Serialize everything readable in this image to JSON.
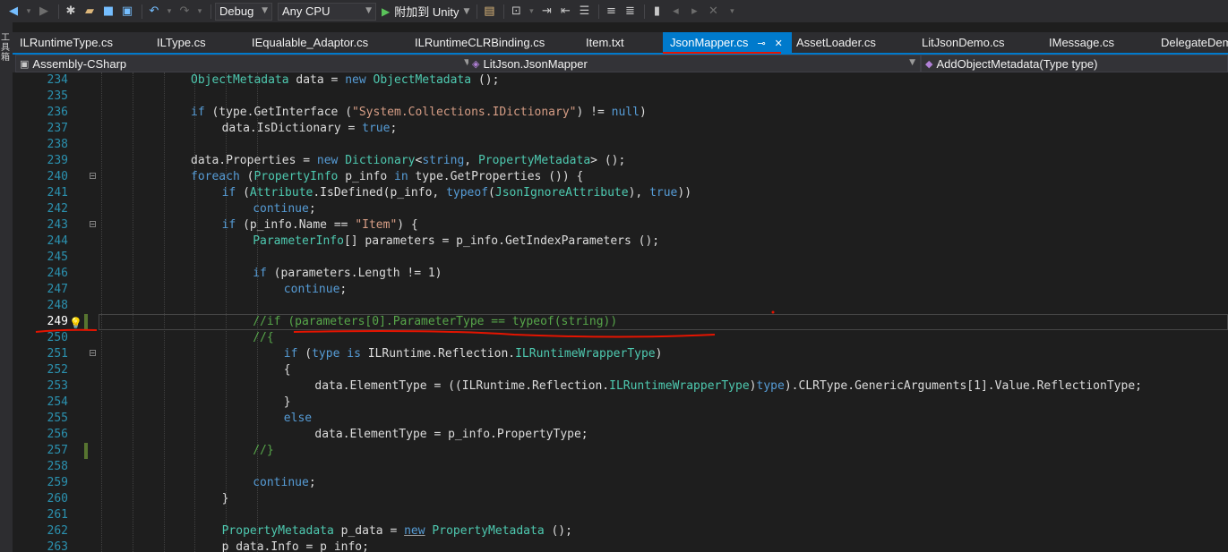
{
  "toolbar": {
    "config": "Debug",
    "platform": "Any CPU",
    "attach_label": "附加到 Unity"
  },
  "left_strip": {
    "label": "工具箱"
  },
  "tabs": [
    {
      "label": "ILRuntimeType.cs",
      "active": false
    },
    {
      "label": "ILType.cs",
      "active": false
    },
    {
      "label": "IEqualable_Adaptor.cs",
      "active": false
    },
    {
      "label": "ILRuntimeCLRBinding.cs",
      "active": false
    },
    {
      "label": "Item.txt",
      "active": false
    },
    {
      "label": "JsonMapper.cs",
      "active": true
    },
    {
      "label": "AssetLoader.cs",
      "active": false
    },
    {
      "label": "LitJsonDemo.cs",
      "active": false
    },
    {
      "label": "IMessage.cs",
      "active": false
    },
    {
      "label": "DelegateDem",
      "active": false
    }
  ],
  "nav": {
    "project": "Assembly-CSharp",
    "type": "LitJson.JsonMapper",
    "member": "AddObjectMetadata(Type type)"
  },
  "colors": {
    "accent": "#007acc",
    "annotation_red": "#e51400",
    "line_number": "#2b91af",
    "keyword": "#569cd6",
    "type": "#4ec9b0",
    "string": "#d69d85",
    "comment": "#57a64a"
  },
  "code": {
    "current_line": 249,
    "lines": [
      {
        "n": "234",
        "indent": 0,
        "tokens": [
          [
            "ty",
            "ObjectMetadata"
          ],
          [
            "pl",
            " data = "
          ],
          [
            "kw",
            "new"
          ],
          [
            "pl",
            " "
          ],
          [
            "ty",
            "ObjectMetadata"
          ],
          [
            "pl",
            " ();"
          ]
        ]
      },
      {
        "n": "235",
        "indent": 0,
        "tokens": []
      },
      {
        "n": "236",
        "indent": 0,
        "tokens": [
          [
            "kw",
            "if"
          ],
          [
            "pl",
            " (type.GetInterface ("
          ],
          [
            "str",
            "\"System.Collections.IDictionary\""
          ],
          [
            "pl",
            ") != "
          ],
          [
            "kw",
            "null"
          ],
          [
            "pl",
            ")"
          ]
        ]
      },
      {
        "n": "237",
        "indent": 1,
        "tokens": [
          [
            "pl",
            "data.IsDictionary = "
          ],
          [
            "kw",
            "true"
          ],
          [
            "pl",
            ";"
          ]
        ]
      },
      {
        "n": "238",
        "indent": 0,
        "tokens": []
      },
      {
        "n": "239",
        "indent": 0,
        "tokens": [
          [
            "pl",
            "data.Properties = "
          ],
          [
            "kw",
            "new"
          ],
          [
            "pl",
            " "
          ],
          [
            "ty",
            "Dictionary"
          ],
          [
            "pl",
            "<"
          ],
          [
            "kw",
            "string"
          ],
          [
            "pl",
            ", "
          ],
          [
            "ty",
            "PropertyMetadata"
          ],
          [
            "pl",
            "> ();"
          ]
        ]
      },
      {
        "n": "240",
        "indent": 0,
        "fold": "−",
        "tokens": [
          [
            "kw",
            "foreach"
          ],
          [
            "pl",
            " ("
          ],
          [
            "ty",
            "PropertyInfo"
          ],
          [
            "pl",
            " p_info "
          ],
          [
            "kw",
            "in"
          ],
          [
            "pl",
            " type.GetProperties ()) {"
          ]
        ]
      },
      {
        "n": "241",
        "indent": 1,
        "tokens": [
          [
            "kw",
            "if"
          ],
          [
            "pl",
            " ("
          ],
          [
            "ty",
            "Attribute"
          ],
          [
            "pl",
            ".IsDefined(p_info, "
          ],
          [
            "kw",
            "typeof"
          ],
          [
            "pl",
            "("
          ],
          [
            "ty",
            "JsonIgnoreAttribute"
          ],
          [
            "pl",
            "), "
          ],
          [
            "kw",
            "true"
          ],
          [
            "pl",
            "))"
          ]
        ]
      },
      {
        "n": "242",
        "indent": 2,
        "tokens": [
          [
            "kw",
            "continue"
          ],
          [
            "pl",
            ";"
          ]
        ]
      },
      {
        "n": "243",
        "indent": 1,
        "fold": "−",
        "tokens": [
          [
            "kw",
            "if"
          ],
          [
            "pl",
            " (p_info.Name == "
          ],
          [
            "str",
            "\"Item\""
          ],
          [
            "pl",
            ") {"
          ]
        ]
      },
      {
        "n": "244",
        "indent": 2,
        "tokens": [
          [
            "ty",
            "ParameterInfo"
          ],
          [
            "pl",
            "[] parameters = p_info.GetIndexParameters ();"
          ]
        ]
      },
      {
        "n": "245",
        "indent": 0,
        "tokens": []
      },
      {
        "n": "246",
        "indent": 2,
        "tokens": [
          [
            "kw",
            "if"
          ],
          [
            "pl",
            " (parameters.Length != 1)"
          ]
        ]
      },
      {
        "n": "247",
        "indent": 3,
        "tokens": [
          [
            "kw",
            "continue"
          ],
          [
            "pl",
            ";"
          ]
        ]
      },
      {
        "n": "248",
        "indent": 0,
        "tokens": []
      },
      {
        "n": "249",
        "indent": 2,
        "bulb": true,
        "chg": true,
        "tokens": [
          [
            "com",
            "//if (parameters[0].ParameterType == typeof(string))"
          ]
        ]
      },
      {
        "n": "250",
        "indent": 2,
        "tokens": [
          [
            "com",
            "//{"
          ]
        ]
      },
      {
        "n": "251",
        "indent": 3,
        "fold": "−",
        "tokens": [
          [
            "kw",
            "if"
          ],
          [
            "pl",
            " ("
          ],
          [
            "kw",
            "type"
          ],
          [
            "pl",
            " "
          ],
          [
            "kw",
            "is"
          ],
          [
            "pl",
            " ILRuntime.Reflection."
          ],
          [
            "ty",
            "ILRuntimeWrapperType"
          ],
          [
            "pl",
            ")"
          ]
        ]
      },
      {
        "n": "252",
        "indent": 3,
        "tokens": [
          [
            "pl",
            "{"
          ]
        ]
      },
      {
        "n": "253",
        "indent": 4,
        "tokens": [
          [
            "pl",
            "data.ElementType = ((ILRuntime.Reflection."
          ],
          [
            "ty",
            "ILRuntimeWrapperType"
          ],
          [
            "pl",
            ")"
          ],
          [
            "kw",
            "type"
          ],
          [
            "pl",
            ").CLRType.GenericArguments[1].Value.ReflectionType;"
          ]
        ]
      },
      {
        "n": "254",
        "indent": 3,
        "tokens": [
          [
            "pl",
            "}"
          ]
        ]
      },
      {
        "n": "255",
        "indent": 3,
        "tokens": [
          [
            "kw",
            "else"
          ]
        ]
      },
      {
        "n": "256",
        "indent": 4,
        "tokens": [
          [
            "pl",
            "data.ElementType = p_info.PropertyType;"
          ]
        ]
      },
      {
        "n": "257",
        "indent": 2,
        "chg": true,
        "tokens": [
          [
            "com",
            "//}"
          ]
        ]
      },
      {
        "n": "258",
        "indent": 0,
        "tokens": []
      },
      {
        "n": "259",
        "indent": 2,
        "tokens": [
          [
            "kw",
            "continue"
          ],
          [
            "pl",
            ";"
          ]
        ]
      },
      {
        "n": "260",
        "indent": 1,
        "tokens": [
          [
            "pl",
            "}"
          ]
        ]
      },
      {
        "n": "261",
        "indent": 0,
        "tokens": []
      },
      {
        "n": "262",
        "indent": 1,
        "tokens": [
          [
            "ty",
            "PropertyMetadata"
          ],
          [
            "pl",
            " p_data = "
          ],
          [
            "kwu",
            "new"
          ],
          [
            "pl",
            " "
          ],
          [
            "ty",
            "PropertyMetadata"
          ],
          [
            "pl",
            " ();"
          ]
        ]
      },
      {
        "n": "263",
        "indent": 1,
        "tokens": [
          [
            "pl",
            "p_data.Info = p_info;"
          ]
        ]
      }
    ]
  }
}
